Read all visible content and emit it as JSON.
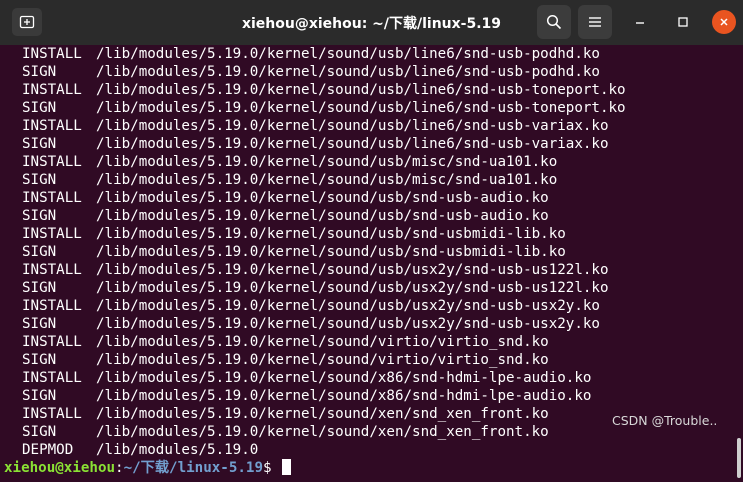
{
  "window": {
    "title": "xiehou@xiehou: ~/下载/linux-5.19"
  },
  "titlebar": {
    "icons": [
      "new-tab-icon",
      "search-icon",
      "hamburger-menu-icon",
      "minimize-icon",
      "maximize-icon",
      "close-icon"
    ]
  },
  "terminal": {
    "lines": [
      {
        "cmd": "INSTALL",
        "path": "/lib/modules/5.19.0/kernel/sound/usb/line6/snd-usb-podhd.ko"
      },
      {
        "cmd": "SIGN",
        "path": "/lib/modules/5.19.0/kernel/sound/usb/line6/snd-usb-podhd.ko"
      },
      {
        "cmd": "INSTALL",
        "path": "/lib/modules/5.19.0/kernel/sound/usb/line6/snd-usb-toneport.ko"
      },
      {
        "cmd": "SIGN",
        "path": "/lib/modules/5.19.0/kernel/sound/usb/line6/snd-usb-toneport.ko"
      },
      {
        "cmd": "INSTALL",
        "path": "/lib/modules/5.19.0/kernel/sound/usb/line6/snd-usb-variax.ko"
      },
      {
        "cmd": "SIGN",
        "path": "/lib/modules/5.19.0/kernel/sound/usb/line6/snd-usb-variax.ko"
      },
      {
        "cmd": "INSTALL",
        "path": "/lib/modules/5.19.0/kernel/sound/usb/misc/snd-ua101.ko"
      },
      {
        "cmd": "SIGN",
        "path": "/lib/modules/5.19.0/kernel/sound/usb/misc/snd-ua101.ko"
      },
      {
        "cmd": "INSTALL",
        "path": "/lib/modules/5.19.0/kernel/sound/usb/snd-usb-audio.ko"
      },
      {
        "cmd": "SIGN",
        "path": "/lib/modules/5.19.0/kernel/sound/usb/snd-usb-audio.ko"
      },
      {
        "cmd": "INSTALL",
        "path": "/lib/modules/5.19.0/kernel/sound/usb/snd-usbmidi-lib.ko"
      },
      {
        "cmd": "SIGN",
        "path": "/lib/modules/5.19.0/kernel/sound/usb/snd-usbmidi-lib.ko"
      },
      {
        "cmd": "INSTALL",
        "path": "/lib/modules/5.19.0/kernel/sound/usb/usx2y/snd-usb-us122l.ko"
      },
      {
        "cmd": "SIGN",
        "path": "/lib/modules/5.19.0/kernel/sound/usb/usx2y/snd-usb-us122l.ko"
      },
      {
        "cmd": "INSTALL",
        "path": "/lib/modules/5.19.0/kernel/sound/usb/usx2y/snd-usb-usx2y.ko"
      },
      {
        "cmd": "SIGN",
        "path": "/lib/modules/5.19.0/kernel/sound/usb/usx2y/snd-usb-usx2y.ko"
      },
      {
        "cmd": "INSTALL",
        "path": "/lib/modules/5.19.0/kernel/sound/virtio/virtio_snd.ko"
      },
      {
        "cmd": "SIGN",
        "path": "/lib/modules/5.19.0/kernel/sound/virtio/virtio_snd.ko"
      },
      {
        "cmd": "INSTALL",
        "path": "/lib/modules/5.19.0/kernel/sound/x86/snd-hdmi-lpe-audio.ko"
      },
      {
        "cmd": "SIGN",
        "path": "/lib/modules/5.19.0/kernel/sound/x86/snd-hdmi-lpe-audio.ko"
      },
      {
        "cmd": "INSTALL",
        "path": "/lib/modules/5.19.0/kernel/sound/xen/snd_xen_front.ko"
      },
      {
        "cmd": "SIGN",
        "path": "/lib/modules/5.19.0/kernel/sound/xen/snd_xen_front.ko"
      },
      {
        "cmd": "DEPMOD",
        "path": "/lib/modules/5.19.0"
      }
    ],
    "prompt": {
      "user_host": "xiehou@xiehou",
      "colon": ":",
      "path": "~/下载/linux-5.19",
      "symbol": "$"
    }
  },
  "watermark": {
    "text": "CSDN @Trouble.."
  },
  "colors": {
    "background": "#300a24",
    "titlebar": "#2b2b2b",
    "prompt_user": "#8ae234",
    "prompt_path": "#729fcf",
    "close_button": "#e95420"
  }
}
